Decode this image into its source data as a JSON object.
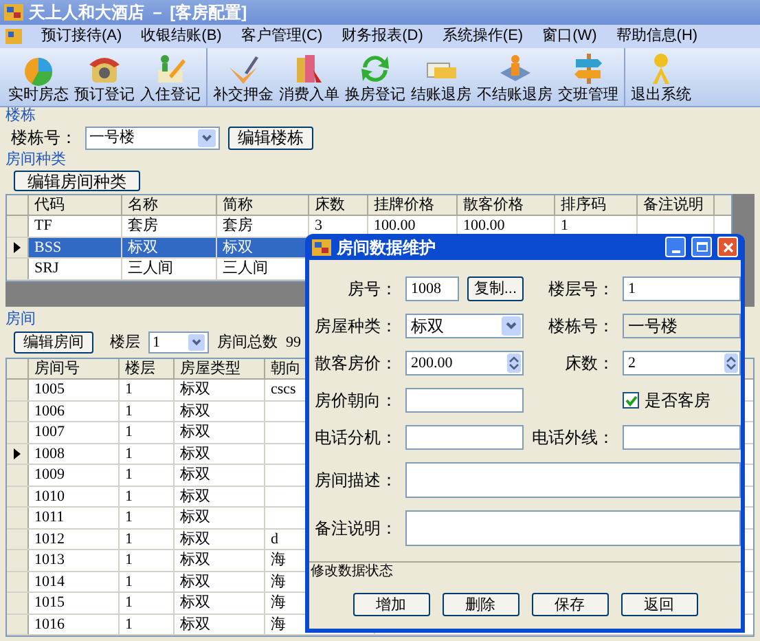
{
  "window": {
    "title": "天上人和大酒店 － [客房配置]"
  },
  "menu": [
    "预订接待(A)",
    "收银结账(B)",
    "客户管理(C)",
    "财务报表(D)",
    "系统操作(E)",
    "窗口(W)",
    "帮助信息(H)"
  ],
  "toolbar": [
    [
      "实时房态",
      "预订登记",
      "入住登记"
    ],
    [
      "补交押金",
      "消费入单",
      "换房登记",
      "结账退房",
      "不结账退房",
      "交班管理"
    ],
    [
      "退出系统"
    ]
  ],
  "building": {
    "label": "楼栋",
    "field_label": "楼栋号：",
    "value": "一号楼",
    "button": "编辑楼栋"
  },
  "room_types": {
    "label": "房间种类",
    "button": "编辑房间种类",
    "columns": [
      "代码",
      "名称",
      "简称",
      "床数",
      "挂牌价格",
      "散客价格",
      "排序码",
      "备注说明"
    ],
    "rows": [
      {
        "cells": [
          "TF",
          "套房",
          "套房",
          "3",
          "100.00",
          "100.00",
          "1"
        ],
        "selected": false
      },
      {
        "cells": [
          "BSS",
          "标双",
          "标双"
        ],
        "selected": true
      },
      {
        "cells": [
          "SRJ",
          "三人间",
          "三人间"
        ],
        "selected": false
      }
    ]
  },
  "rooms": {
    "label": "房间",
    "button": "编辑房间",
    "floor_label": "楼层",
    "floor_value": "1",
    "total_label": "房间总数",
    "total": "99",
    "columns": [
      "房间号",
      "楼层",
      "房屋类型",
      "朝向"
    ],
    "rows": [
      {
        "cells": [
          "1005",
          "1",
          "标双",
          "cscs"
        ],
        "current": false
      },
      {
        "cells": [
          "1006",
          "1",
          "标双"
        ],
        "current": false
      },
      {
        "cells": [
          "1007",
          "1",
          "标双"
        ],
        "current": false
      },
      {
        "cells": [
          "1008",
          "1",
          "标双"
        ],
        "current": true
      },
      {
        "cells": [
          "1009",
          "1",
          "标双"
        ],
        "current": false
      },
      {
        "cells": [
          "1010",
          "1",
          "标双"
        ],
        "current": false
      },
      {
        "cells": [
          "1011",
          "1",
          "标双"
        ],
        "current": false
      },
      {
        "cells": [
          "1012",
          "1",
          "标双",
          "d"
        ],
        "current": false
      },
      {
        "cells": [
          "1013",
          "1",
          "标双",
          "海"
        ],
        "current": false
      },
      {
        "cells": [
          "1014",
          "1",
          "标双",
          "海"
        ],
        "current": false
      },
      {
        "cells": [
          "1015",
          "1",
          "标双",
          "海"
        ],
        "current": false
      },
      {
        "cells": [
          "1016",
          "1",
          "标双",
          "海"
        ],
        "current": false
      }
    ]
  },
  "dialog": {
    "title": "房间数据维护",
    "items": [
      {
        "kind": "label",
        "text": "房号："
      },
      {
        "kind": "textbutton",
        "value": "1008",
        "button": "复制..."
      },
      {
        "kind": "label",
        "text": "楼层号："
      },
      {
        "kind": "text",
        "value": "1"
      },
      {
        "kind": "label",
        "text": "房屋种类："
      },
      {
        "kind": "combo",
        "value": "标双"
      },
      {
        "kind": "label",
        "text": "楼栋号："
      },
      {
        "kind": "readonly",
        "value": "一号楼"
      },
      {
        "kind": "label",
        "text": "散客房价："
      },
      {
        "kind": "spin",
        "value": "200.00"
      },
      {
        "kind": "label",
        "text": "床数："
      },
      {
        "kind": "spin",
        "value": "2"
      },
      {
        "kind": "label",
        "text": "房价朝向："
      },
      {
        "kind": "text"
      },
      {
        "kind": "blank"
      },
      {
        "kind": "check",
        "text": "是否客房",
        "checked": true
      },
      {
        "kind": "label",
        "text": "电话分机："
      },
      {
        "kind": "text"
      },
      {
        "kind": "label",
        "text": "电话外线："
      },
      {
        "kind": "text"
      },
      {
        "kind": "label",
        "text": "房间描述："
      },
      {
        "kind": "memo"
      },
      {
        "kind": "label",
        "text": "备注说明："
      },
      {
        "kind": "memo"
      }
    ],
    "status": "修改数据状态",
    "buttons": [
      "增加",
      "删除",
      "保存",
      "返回"
    ]
  }
}
